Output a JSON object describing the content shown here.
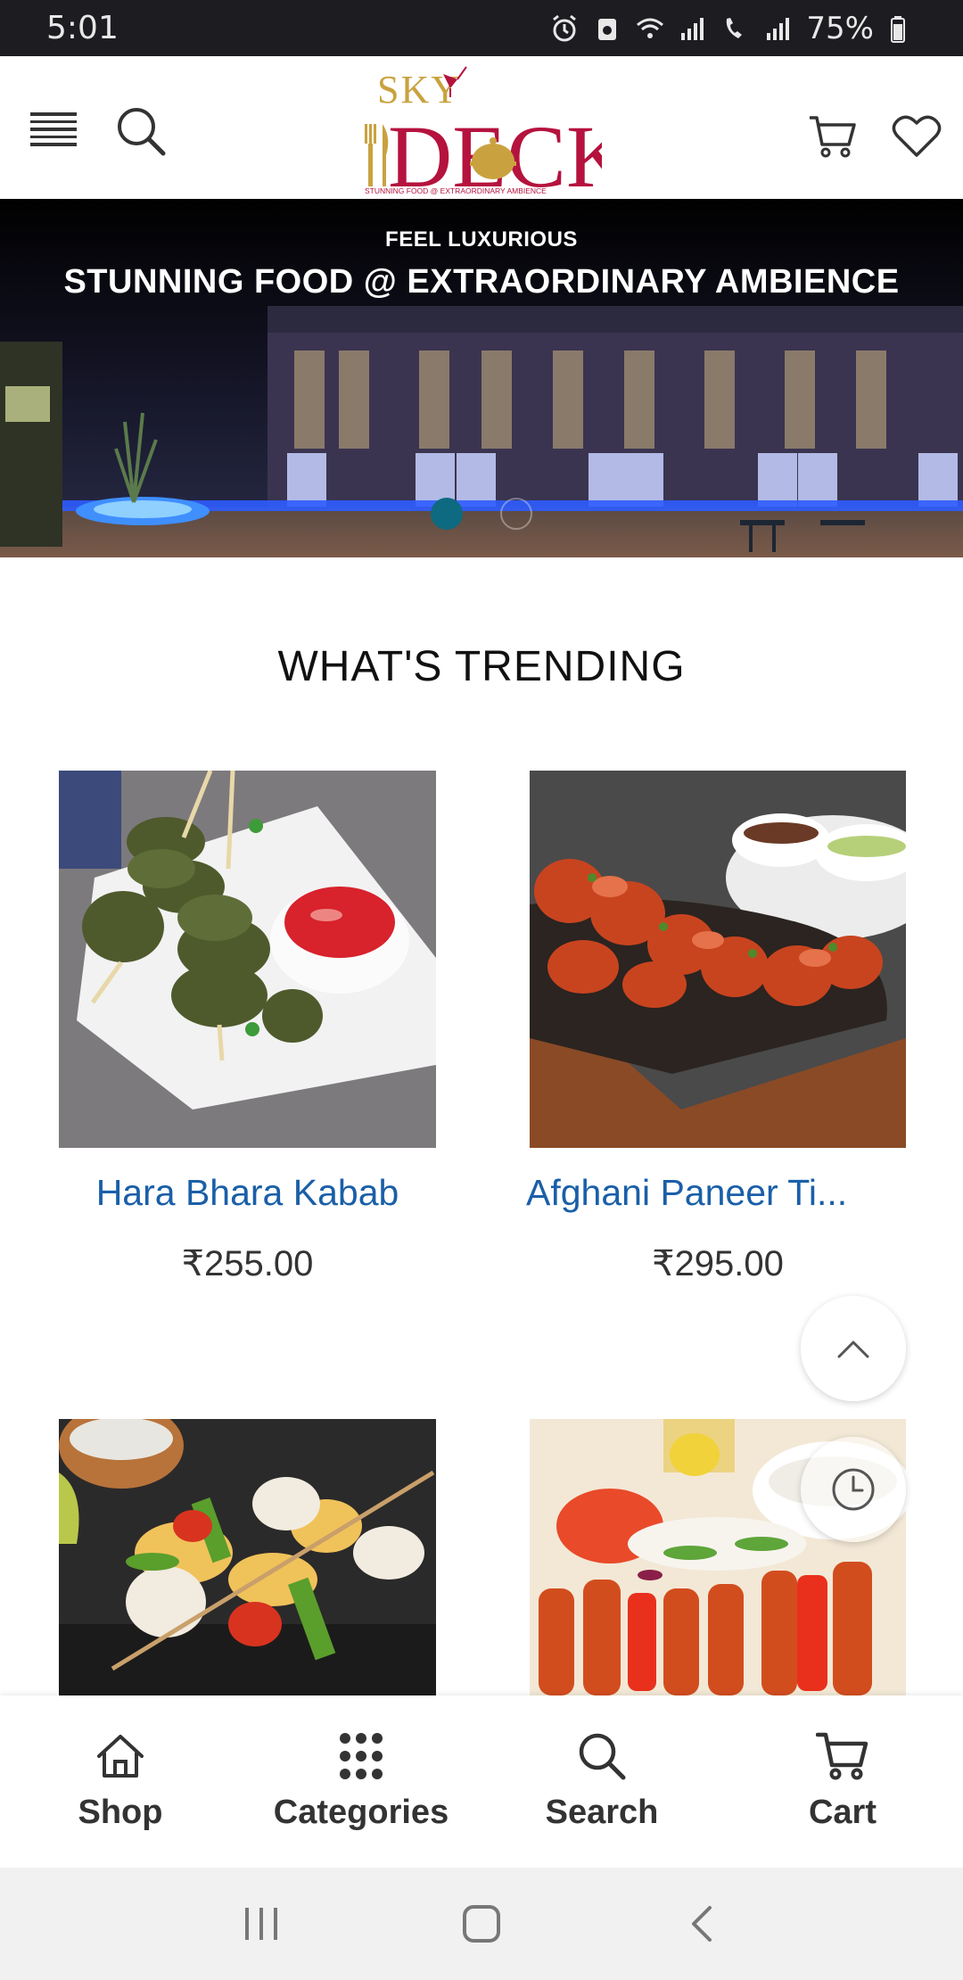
{
  "status_bar": {
    "time": "5:01",
    "battery": "75%",
    "icons": [
      "alarm-icon",
      "app-notification-icon",
      "wifi-icon",
      "signal-icon",
      "wifi-calling-icon",
      "signal-icon-2",
      "battery-icon"
    ]
  },
  "header": {
    "logo_text_top": "SKY",
    "logo_text_main": "DECK",
    "logo_tagline": "STUNNING FOOD @ EXTRAORDINARY AMBIENCE",
    "icons": [
      "menu-icon",
      "search-icon",
      "cart-icon",
      "heart-icon"
    ]
  },
  "hero": {
    "kicker": "FEEL LUXURIOUS",
    "title": "STUNNING FOOD @ EXTRAORDINARY AMBIENCE",
    "slide_count": 2,
    "active_slide": 1
  },
  "trending": {
    "title": "WHAT'S TRENDING",
    "products": [
      {
        "name": "Hara Bhara Kabab",
        "price": "₹255.00"
      },
      {
        "name": "Afghani Paneer Ti...",
        "price": "₹295.00"
      },
      {
        "name": "",
        "price": ""
      },
      {
        "name": "",
        "price": ""
      }
    ]
  },
  "bottom_nav": {
    "items": [
      {
        "label": "Shop",
        "icon": "home-icon"
      },
      {
        "label": "Categories",
        "icon": "grid-icon"
      },
      {
        "label": "Search",
        "icon": "search-icon"
      },
      {
        "label": "Cart",
        "icon": "cart-icon"
      }
    ]
  },
  "colors": {
    "accent": "#1a5fa8",
    "logo_red": "#b5123e",
    "logo_gold": "#c9a23f",
    "dot_active": "#0e6a80"
  }
}
